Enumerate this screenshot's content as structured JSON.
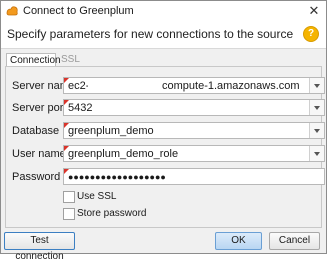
{
  "window": {
    "title": "Connect to Greenplum"
  },
  "header": {
    "text": "Specify parameters for new connections to the source"
  },
  "tabs": [
    {
      "label": "Connection"
    },
    {
      "label": "SSL"
    }
  ],
  "fields": {
    "server_name": {
      "label": "Server name",
      "value_prefix": "ec2-",
      "value_suffix": "compute-1.amazonaws.com"
    },
    "server_port": {
      "label": "Server port",
      "value": "5432"
    },
    "database": {
      "label": "Database",
      "value": "greenplum_demo"
    },
    "user_name": {
      "label": "User name",
      "value": "greenplum_demo_role"
    },
    "password": {
      "label": "Password",
      "value": "●●●●●●●●●●●●●●●●●●"
    }
  },
  "options": {
    "use_ssl": "Use SSL",
    "store_password": "Store password"
  },
  "buttons": {
    "test": "Test connection",
    "ok": "OK",
    "cancel": "Cancel"
  },
  "colors": {
    "required_marker": "#d9342b",
    "help_icon": "#f5b400",
    "focus_border": "#3c7fc2"
  }
}
